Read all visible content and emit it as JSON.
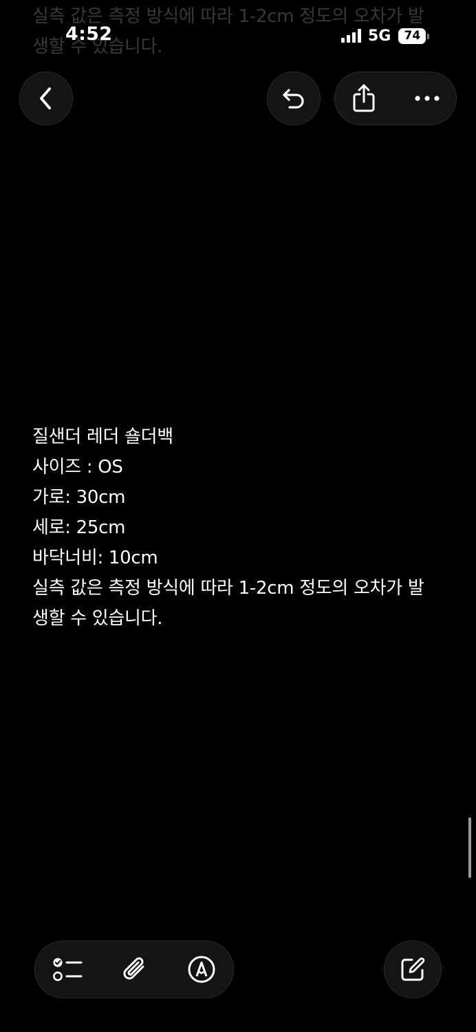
{
  "ghost_text": {
    "lines": [
      "실측 값은 측정 방식에 따라 1-2cm 정도의 오차가 발",
      "생할 수 있습니다."
    ]
  },
  "status_bar": {
    "time": "4:52",
    "network": "5G",
    "battery": "74"
  },
  "top_nav": {
    "back_icon": "chevron-left-icon",
    "undo_icon": "undo-icon",
    "share_icon": "share-icon",
    "more_icon": "ellipsis-icon"
  },
  "note": {
    "lines": [
      "질샌더 레더 숄더백",
      "사이즈 : OS",
      "가로: 30cm",
      "세로: 25cm",
      "바닥너비: 10cm",
      "실측 값은 측정 방식에 따라 1-2cm 정도의 오차가 발",
      "생할 수 있습니다."
    ]
  },
  "bottom_toolbar": {
    "checklist_icon": "checklist-icon",
    "attachment_icon": "paperclip-icon",
    "markup_icon": "markup-pen-icon",
    "compose_icon": "compose-icon"
  },
  "colors": {
    "background": "#000000",
    "button_fill": "#141414",
    "text": "#ffffff"
  }
}
